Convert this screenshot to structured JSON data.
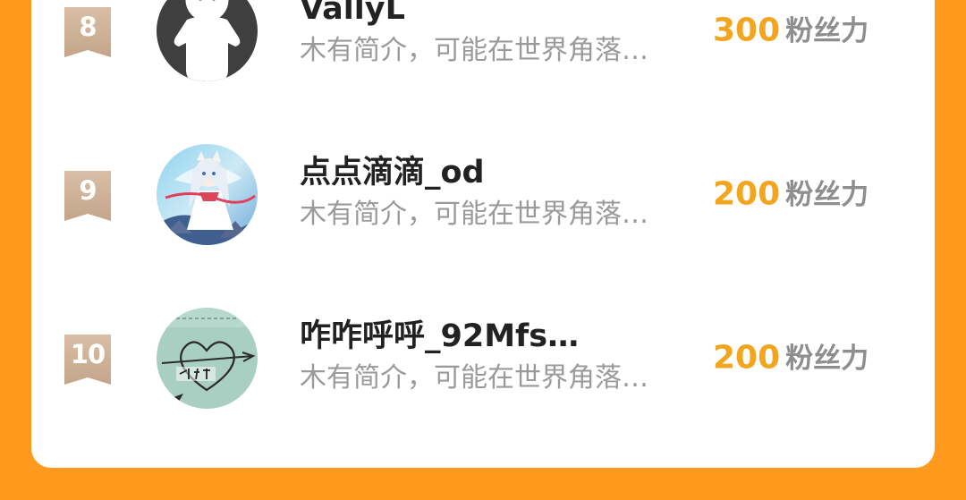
{
  "list": {
    "rows": [
      {
        "rank": "8",
        "username": "VallyL",
        "bio": "木有简介，可能在世界角落…",
        "fans_value": "300",
        "fans_label": "粉丝力",
        "avatar": "default-person-avatar"
      },
      {
        "rank": "9",
        "username": "点点滴滴_od",
        "bio": "木有简介，可能在世界角落…",
        "fans_value": "200",
        "fans_label": "粉丝力",
        "avatar": "anime-girl-avatar"
      },
      {
        "rank": "10",
        "username": "咋咋呼呼_92Mfs…",
        "bio": "木有简介，可能在世界角落…",
        "fans_value": "200",
        "fans_label": "粉丝力",
        "avatar": "heart-sketch-avatar"
      }
    ]
  },
  "colors": {
    "page_background": "#FF9A1F",
    "card_background": "#FFFFFF",
    "rank_badge": "#CBAE92",
    "fans_value": "#F2A51E",
    "fans_label": "#8E8E8E",
    "username": "#222222",
    "bio": "#9A9A9A"
  }
}
